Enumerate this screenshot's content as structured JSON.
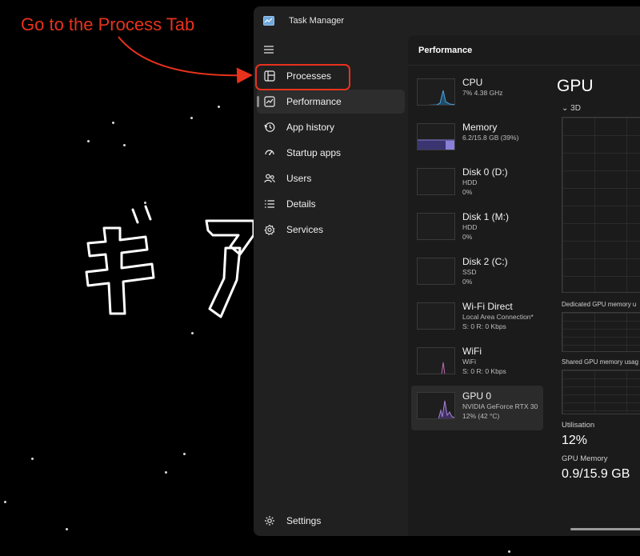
{
  "annotation": {
    "text": "Go to the Process Tab"
  },
  "wallpaper": {
    "glyphs": "ギア"
  },
  "window": {
    "title": "Task Manager"
  },
  "nav": {
    "items": [
      {
        "label": "Processes",
        "icon": "processes-icon"
      },
      {
        "label": "Performance",
        "icon": "performance-icon"
      },
      {
        "label": "App history",
        "icon": "app-history-icon"
      },
      {
        "label": "Startup apps",
        "icon": "startup-apps-icon"
      },
      {
        "label": "Users",
        "icon": "users-icon"
      },
      {
        "label": "Details",
        "icon": "details-icon"
      },
      {
        "label": "Services",
        "icon": "services-icon"
      }
    ],
    "active": "Performance",
    "settings_label": "Settings"
  },
  "content": {
    "header": "Performance",
    "devices": [
      {
        "name": "CPU",
        "line1": "7%  4.38 GHz",
        "line2": "",
        "color": "#4aa3df"
      },
      {
        "name": "Memory",
        "line1": "6.2/15.8 GB (39%)",
        "line2": "",
        "color": "#8a7fd6"
      },
      {
        "name": "Disk 0 (D:)",
        "line1": "HDD",
        "line2": "0%",
        "color": "#5a8f3a"
      },
      {
        "name": "Disk 1 (M:)",
        "line1": "HDD",
        "line2": "0%",
        "color": "#5a8f3a"
      },
      {
        "name": "Disk 2 (C:)",
        "line1": "SSD",
        "line2": "0%",
        "color": "#5a8f3a"
      },
      {
        "name": "Wi-Fi Direct",
        "line1": "Local Area Connection*",
        "line2": "S: 0  R: 0 Kbps",
        "color": "#c06ab0"
      },
      {
        "name": "WiFi",
        "line1": "WiFi",
        "line2": "S: 0  R: 0 Kbps",
        "color": "#c06ab0"
      },
      {
        "name": "GPU 0",
        "line1": "NVIDIA GeForce RTX 30",
        "line2": "12%  (42 °C)",
        "color": "#a882d6"
      }
    ],
    "selected_device": "GPU 0",
    "detail": {
      "title": "GPU",
      "engine": "3D",
      "dedicated_label": "Dedicated GPU memory u",
      "shared_label": "Shared GPU memory usag",
      "utilisation_label": "Utilisation",
      "utilisation_value": "12%",
      "gpu_memory_label": "GPU Memory",
      "gpu_memory_value": "0.9/15.9 GB"
    }
  }
}
